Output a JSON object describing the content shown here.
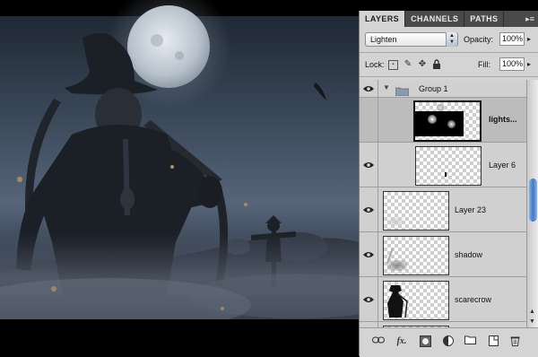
{
  "panel": {
    "tabs": [
      {
        "label": "LAYERS",
        "active": true
      },
      {
        "label": "CHANNELS",
        "active": false
      },
      {
        "label": "PATHS",
        "active": false
      }
    ],
    "menu_icon": "panel-menu-icon",
    "blend_mode": "Lighten",
    "opacity_label": "Opacity:",
    "opacity_value": "100%",
    "lock_label": "Lock:",
    "fill_label": "Fill:",
    "fill_value": "100%"
  },
  "layers": [
    {
      "name": "Group 1",
      "type": "group",
      "visible": true,
      "expanded": true
    },
    {
      "name": "lights...",
      "type": "layer",
      "visible": false,
      "selected": true
    },
    {
      "name": "Layer 6",
      "type": "layer",
      "visible": true
    },
    {
      "name": "Layer 23",
      "type": "layer",
      "visible": true
    },
    {
      "name": "shadow",
      "type": "layer",
      "visible": true
    },
    {
      "name": "scarecrow",
      "type": "layer",
      "visible": true
    },
    {
      "name": "",
      "type": "layer",
      "visible": true
    }
  ],
  "bottom_icons": [
    "link-icon",
    "fx-icon",
    "mask-icon",
    "adjustment-icon",
    "folder-icon",
    "new-layer-icon",
    "trash-icon"
  ],
  "colors": {
    "panel_bg": "#d4d4d4",
    "tab_bar": "#4a4a4a",
    "selected_row": "#bcbcbc",
    "scroll_thumb": "#3f78c8",
    "sky": "#34404f"
  }
}
